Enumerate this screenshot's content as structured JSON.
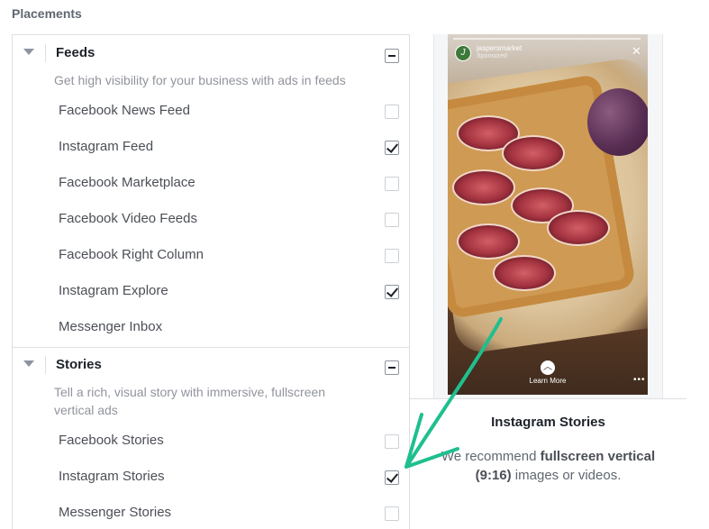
{
  "header": {
    "title": "Placements"
  },
  "feeds": {
    "name": "Feeds",
    "description": "Get high visibility for your business with ads in feeds",
    "items": [
      {
        "label": "Facebook News Feed",
        "checked": false
      },
      {
        "label": "Instagram Feed",
        "checked": true
      },
      {
        "label": "Facebook Marketplace",
        "checked": false
      },
      {
        "label": "Facebook Video Feeds",
        "checked": false
      },
      {
        "label": "Facebook Right Column",
        "checked": false
      },
      {
        "label": "Instagram Explore",
        "checked": true
      },
      {
        "label": "Messenger Inbox",
        "checked": null
      }
    ]
  },
  "stories": {
    "name": "Stories",
    "description_line1": "Tell a rich, visual story with immersive, fullscreen",
    "description_line2": "vertical ads",
    "items": [
      {
        "label": "Facebook Stories",
        "checked": false
      },
      {
        "label": "Instagram Stories",
        "checked": true
      },
      {
        "label": "Messenger Stories",
        "checked": false
      }
    ]
  },
  "preview": {
    "account_name": "jaspersmarket",
    "sponsored_label": "Sponsored",
    "avatar_letter": "J",
    "cta_label": "Learn More",
    "title": "Instagram Stories",
    "rec_prefix": "We recommend ",
    "rec_bold1": "fullscreen vertical",
    "rec_bold2": "(9:16)",
    "rec_suffix": " images or videos."
  },
  "colors": {
    "annotation_arrow": "#1fbf8f"
  }
}
